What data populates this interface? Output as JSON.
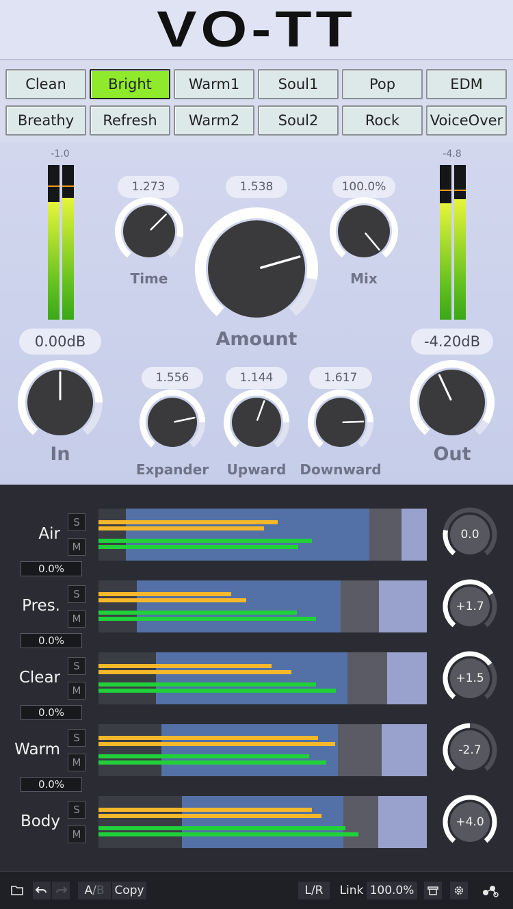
{
  "app": {
    "title": "VO-TT"
  },
  "presets": [
    "Clean",
    "Bright",
    "Warm1",
    "Soul1",
    "Pop",
    "EDM",
    "Breathy",
    "Refresh",
    "Warm2",
    "Soul2",
    "Rock",
    "VoiceOver"
  ],
  "active_preset": "Bright",
  "meters": {
    "in_peak": "-1.0",
    "out_peak": "-4.8"
  },
  "knobs": {
    "time": {
      "label": "Time",
      "value": "1.273"
    },
    "amount": {
      "label": "Amount",
      "value": "1.538"
    },
    "mix": {
      "label": "Mix",
      "value": "100.0%"
    },
    "in": {
      "label": "In",
      "value": "0.00dB"
    },
    "out": {
      "label": "Out",
      "value": "-4.20dB"
    },
    "expander": {
      "label": "Expander",
      "value": "1.556"
    },
    "upward": {
      "label": "Upward",
      "value": "1.144"
    },
    "downward": {
      "label": "Downward",
      "value": "1.617"
    }
  },
  "band_buttons": {
    "solo": "S",
    "mute": "M"
  },
  "bands": [
    {
      "name": "Air",
      "percent": "0.0%",
      "gain": "0.0"
    },
    {
      "name": "Pres.",
      "percent": "0.0%",
      "gain": "+1.7"
    },
    {
      "name": "Clear",
      "percent": "0.0%",
      "gain": "+1.5"
    },
    {
      "name": "Warm",
      "percent": "0.0%",
      "gain": "-2.7"
    },
    {
      "name": "Body",
      "gain": "+4.0"
    }
  ],
  "footer": {
    "ab_a": "A",
    "ab_sep": "/",
    "ab_b": "B",
    "copy": "Copy",
    "lr": "L/R",
    "link_label": "Link",
    "link_value": "100.0%"
  },
  "icons": [
    "folder-icon",
    "undo-icon",
    "redo-icon",
    "bypass-icon",
    "gear-icon",
    "nodes-icon"
  ]
}
